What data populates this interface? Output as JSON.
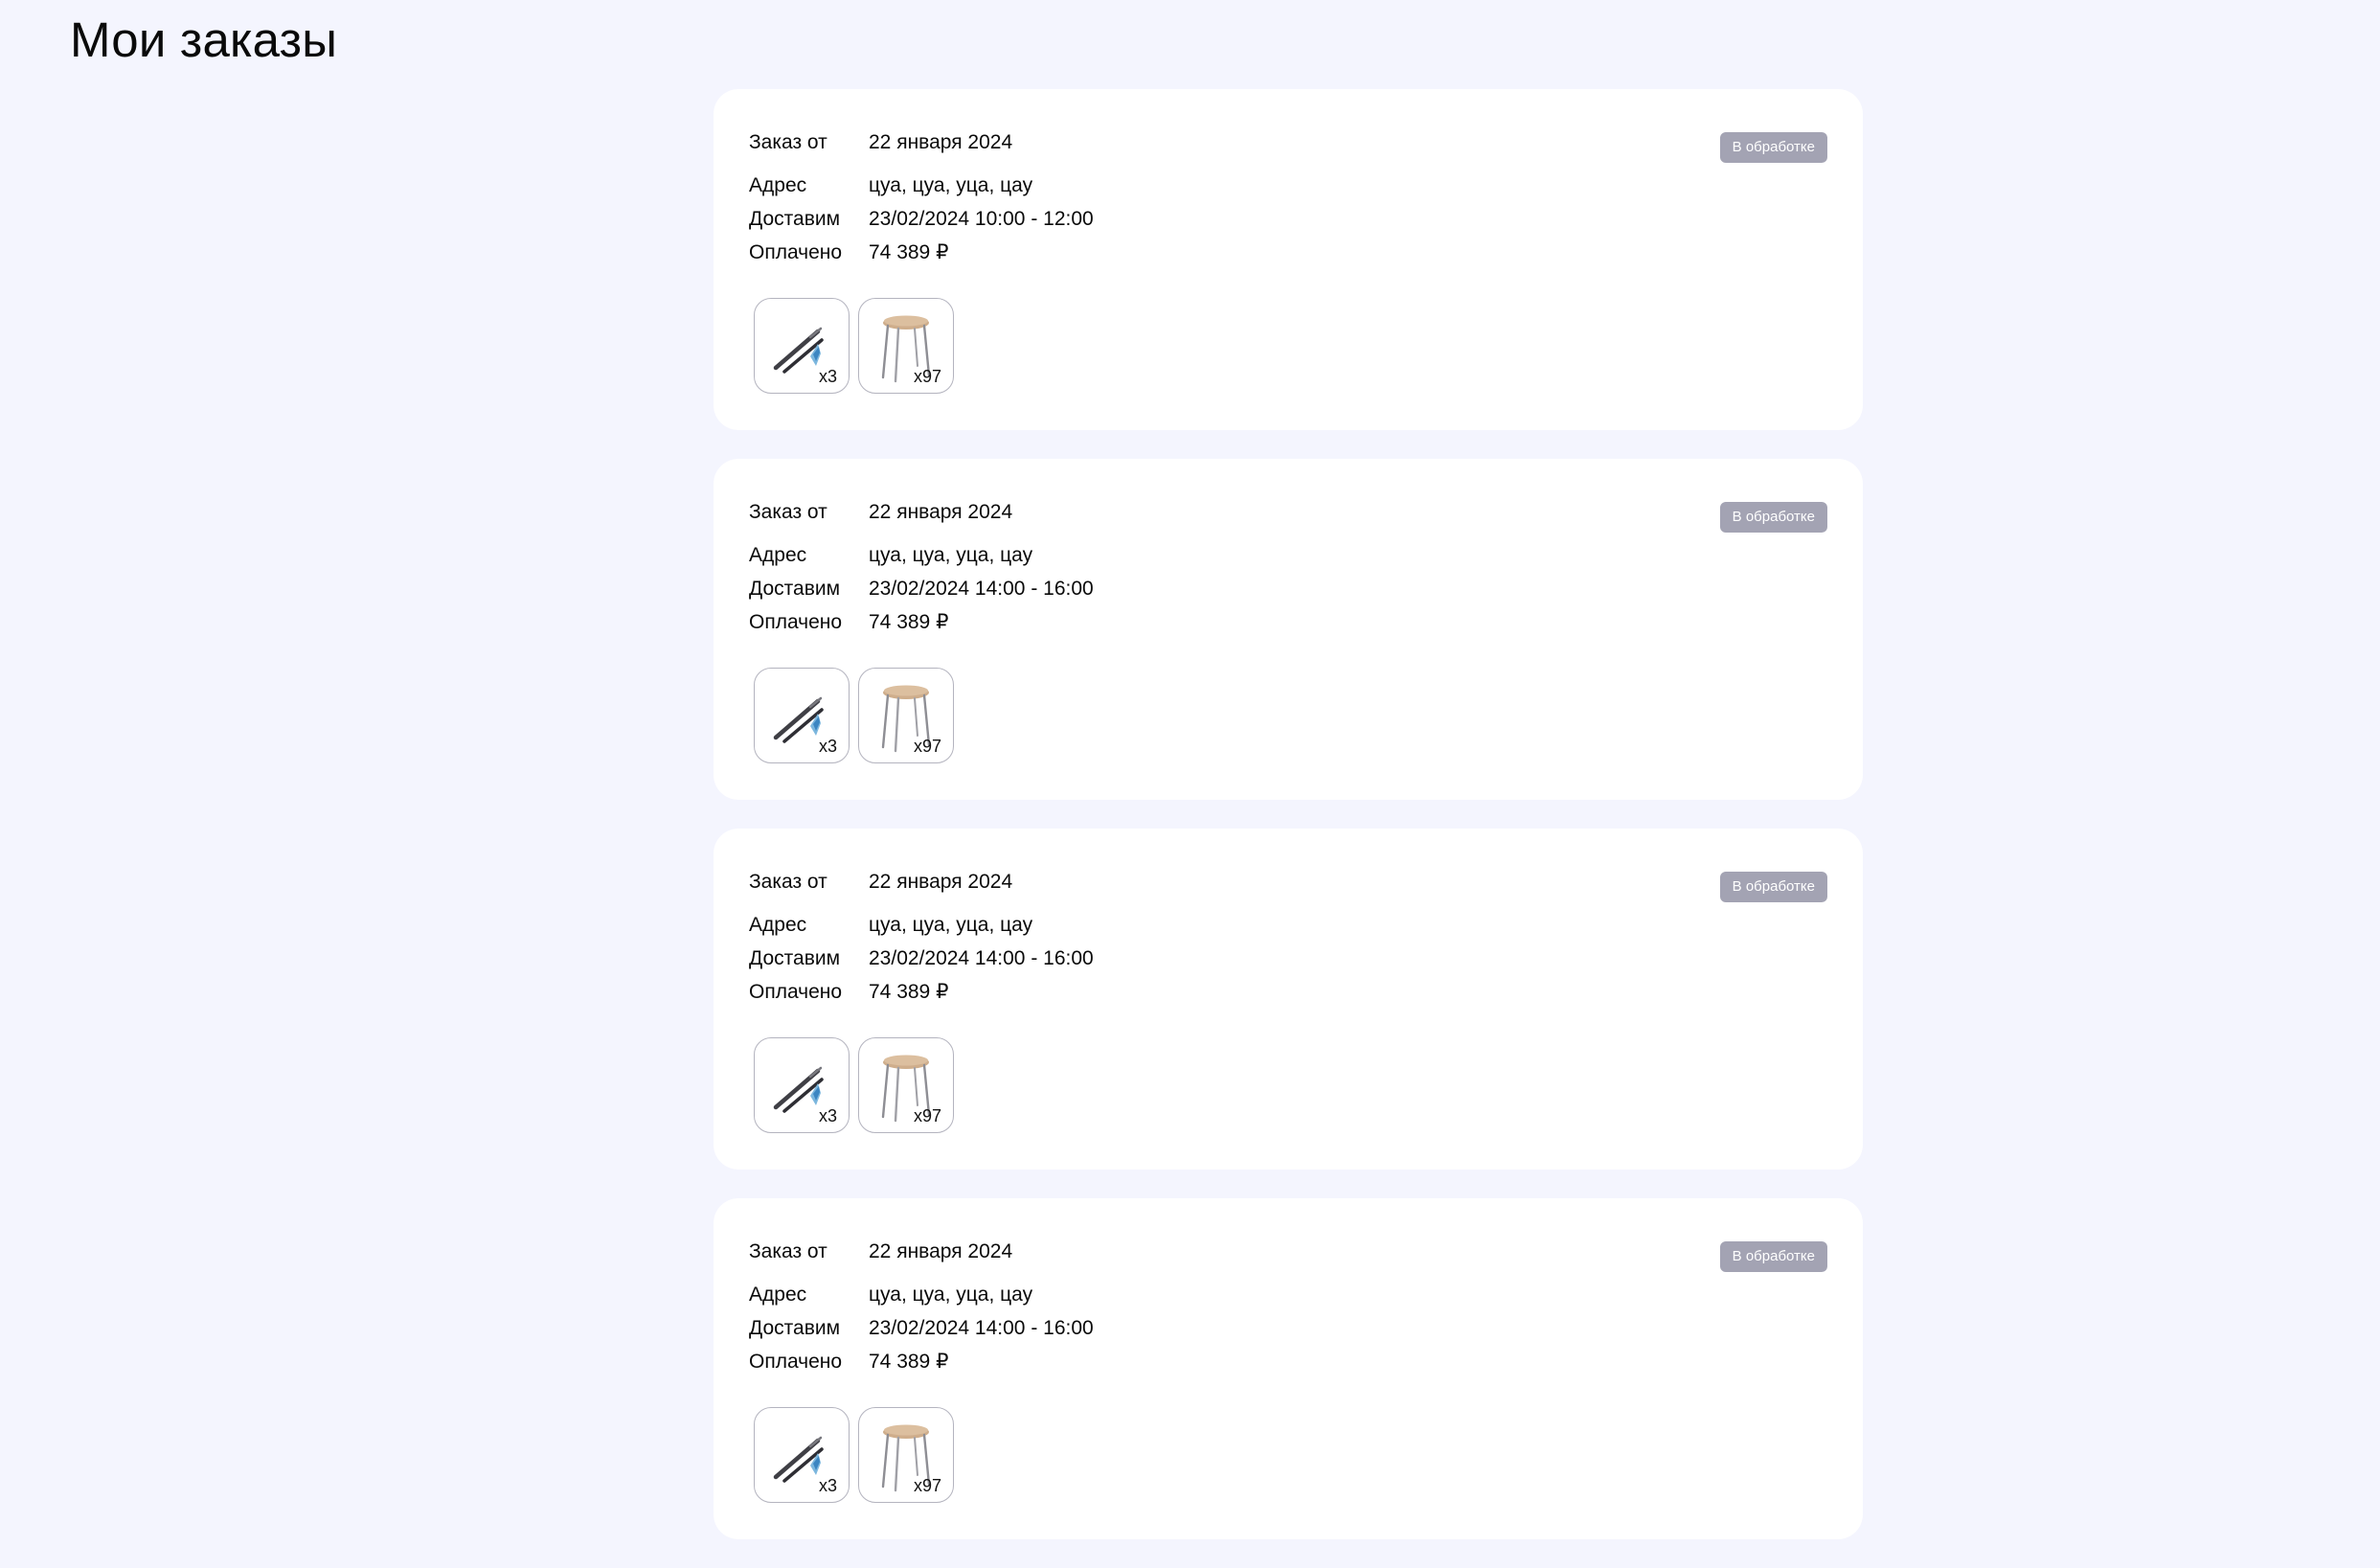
{
  "page": {
    "title": "Мои заказы"
  },
  "colors": {
    "background": "#f4f5fe",
    "card": "#ffffff",
    "status_badge": "#a3a3b3"
  },
  "labels": {
    "order_date": "Заказ от",
    "address": "Адрес",
    "delivery": "Доставим",
    "paid": "Оплачено"
  },
  "orders": [
    {
      "date": "22 января 2024",
      "address": "цуа, цуа, уца, цау",
      "delivery": "23/02/2024 10:00 - 12:00",
      "paid": "74 389 ₽",
      "status": "В обработке",
      "items": [
        {
          "icon": "pen-set-icon",
          "qty": "x3"
        },
        {
          "icon": "stool-icon",
          "qty": "x97"
        }
      ]
    },
    {
      "date": "22 января 2024",
      "address": "цуа, цуа, уца, цау",
      "delivery": "23/02/2024 14:00 - 16:00",
      "paid": "74 389 ₽",
      "status": "В обработке",
      "items": [
        {
          "icon": "pen-set-icon",
          "qty": "x3"
        },
        {
          "icon": "stool-icon",
          "qty": "x97"
        }
      ]
    },
    {
      "date": "22 января 2024",
      "address": "цуа, цуа, уца, цау",
      "delivery": "23/02/2024 14:00 - 16:00",
      "paid": "74 389 ₽",
      "status": "В обработке",
      "items": [
        {
          "icon": "pen-set-icon",
          "qty": "x3"
        },
        {
          "icon": "stool-icon",
          "qty": "x97"
        }
      ]
    },
    {
      "date": "22 января 2024",
      "address": "цуа, цуа, уца, цау",
      "delivery": "23/02/2024 14:00 - 16:00",
      "paid": "74 389 ₽",
      "status": "В обработке",
      "items": [
        {
          "icon": "pen-set-icon",
          "qty": "x3"
        },
        {
          "icon": "stool-icon",
          "qty": "x97"
        }
      ]
    }
  ]
}
